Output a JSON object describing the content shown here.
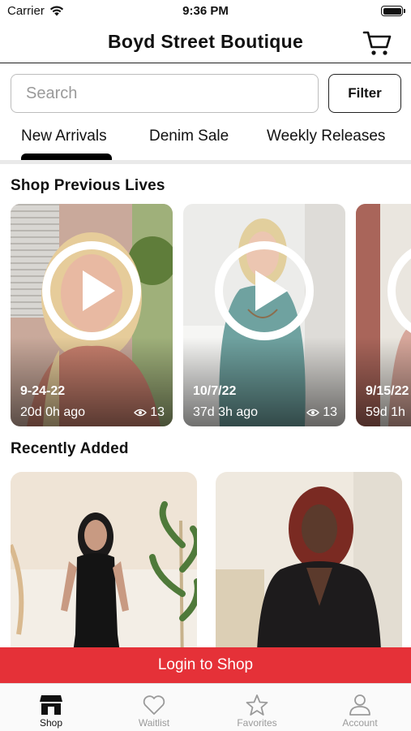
{
  "status_bar": {
    "carrier": "Carrier",
    "time": "9:36 PM"
  },
  "header": {
    "title": "Boyd Street Boutique",
    "cart_icon": "cart-icon"
  },
  "search": {
    "placeholder": "Search",
    "value": ""
  },
  "filter_label": "Filter",
  "tabs": [
    {
      "label": "New Arrivals",
      "active": true
    },
    {
      "label": "Denim Sale",
      "active": false
    },
    {
      "label": "Weekly Releases",
      "active": false
    }
  ],
  "sections": {
    "previous_lives": "Shop Previous Lives",
    "recently_added": "Recently Added"
  },
  "lives": [
    {
      "date": "9-24-22",
      "ago": "20d 0h ago",
      "views": "13"
    },
    {
      "date": "10/7/22",
      "ago": "37d 3h ago",
      "views": "13"
    },
    {
      "date": "9/15/22",
      "ago": "59d 1h",
      "views": ""
    }
  ],
  "login_banner": "Login to Shop",
  "tabbar": [
    {
      "label": "Shop",
      "icon": "storefront-icon",
      "active": true
    },
    {
      "label": "Waitlist",
      "icon": "heart-icon",
      "active": false
    },
    {
      "label": "Favorites",
      "icon": "star-icon",
      "active": false
    },
    {
      "label": "Account",
      "icon": "person-icon",
      "active": false
    }
  ],
  "colors": {
    "brand_red": "#e53138",
    "tab_active": "#000000",
    "tab_inactive": "#9a9a9a"
  }
}
